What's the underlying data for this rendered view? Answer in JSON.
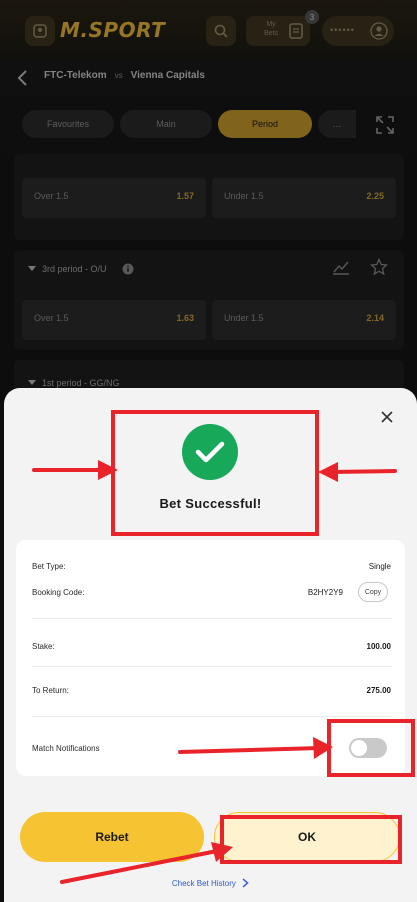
{
  "header": {
    "logo": "M.SPORT",
    "my_bets_label": "My Bets",
    "my_bets_count": "3",
    "balance_mask": "••••••"
  },
  "match": {
    "home": "FTC-Telekom",
    "vs": "vs",
    "away": "Vienna Capitals"
  },
  "tabs": [
    {
      "label": "Favourites"
    },
    {
      "label": "Main"
    },
    {
      "label": "Period"
    },
    {
      "label": "…"
    }
  ],
  "markets": [
    {
      "title": "",
      "left_label": "Over 1.5",
      "left_odd": "1.57",
      "right_label": "Under 1.5",
      "right_odd": "2.25"
    },
    {
      "title": "3rd period - O/U",
      "left_label": "Over 1.5",
      "left_odd": "1.63",
      "right_label": "Under 1.5",
      "right_odd": "2.14"
    },
    {
      "title": "1st period - GG/NG"
    }
  ],
  "modal": {
    "success_text": "Bet Successful!",
    "bet_type_label": "Bet Type:",
    "bet_type_value": "Single",
    "booking_code_label": "Booking Code:",
    "booking_code_value": "B2HY2Y9",
    "copy_label": "Copy",
    "stake_label": "Stake:",
    "stake_value": "100.00",
    "to_return_label": "To Return:",
    "to_return_value": "275.00",
    "notifications_label": "Match Notifications",
    "notifications_on": false,
    "rebet_label": "Rebet",
    "ok_label": "OK",
    "history_label": "Check Bet History"
  },
  "colors": {
    "accent": "#f6c432",
    "success": "#18a85a",
    "annotation": "#e8232a",
    "link": "#2b5bd6"
  }
}
